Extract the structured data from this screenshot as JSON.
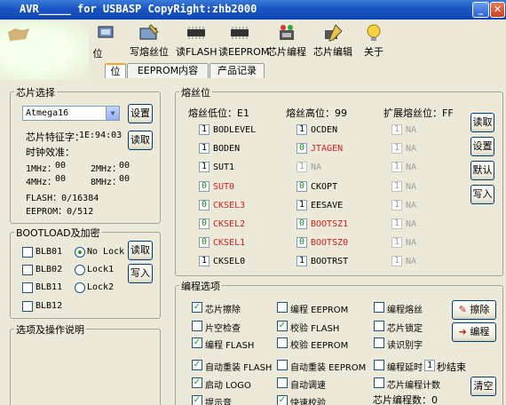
{
  "window": {
    "title": "AVR_____ for USBASP CopyRight:zhb2000"
  },
  "toolbar": {
    "items": [
      {
        "label": "位",
        "icon": "read-fuse-icon"
      },
      {
        "label": "写熔丝位",
        "icon": "write-fuse-icon"
      },
      {
        "label": "读FLASH",
        "icon": "chip-icon"
      },
      {
        "label": "读EEPROM",
        "icon": "chip-icon"
      },
      {
        "label": "芯片编程",
        "icon": "program-chip-icon"
      },
      {
        "label": "芯片编辑",
        "icon": "edit-chip-icon"
      },
      {
        "label": "关于",
        "icon": "lightbulb-icon"
      }
    ]
  },
  "tabs": [
    "位",
    "EEPROM内容",
    "产品记录"
  ],
  "chip_select": {
    "title": "芯片选择",
    "chip": "Atmega16",
    "settings_btn": "设置",
    "signature_label": "芯片特征字：",
    "signature_value": "1E:94:03",
    "read_btn": "读取",
    "clock_label": "时钟效准：",
    "clocks": [
      {
        "label": "1MHz：",
        "value": "00"
      },
      {
        "label": "2MHz：",
        "value": "00"
      },
      {
        "label": "4MHz：",
        "value": "00"
      },
      {
        "label": "8MHz：",
        "value": "00"
      }
    ],
    "flash_text": "FLASH：0/16384",
    "eeprom_text": "EEPROM：0/512"
  },
  "bootload": {
    "title": "BOOTLOAD及加密",
    "checks": [
      "BLB01",
      "BLB02",
      "BLB11",
      "BLB12"
    ],
    "radios": [
      "No Lock",
      "Lock1",
      "Lock2"
    ],
    "selected_radio": "No Lock",
    "read_btn": "读取",
    "write_btn": "写入"
  },
  "ops": {
    "title": "选项及操作说明"
  },
  "fuse": {
    "title": "熔丝位",
    "low_label": "熔丝低位：E1",
    "high_label": "熔丝高位：99",
    "ext_label": "扩展熔丝位：FF",
    "low": [
      {
        "v": "1",
        "name": "BODLEVEL",
        "style": "normal"
      },
      {
        "v": "1",
        "name": "BODEN",
        "style": "normal"
      },
      {
        "v": "1",
        "name": "SUT1",
        "style": "normal"
      },
      {
        "v": "0",
        "name": "SUT0",
        "style": "red"
      },
      {
        "v": "0",
        "name": "CKSEL3",
        "style": "red"
      },
      {
        "v": "0",
        "name": "CKSEL2",
        "style": "red"
      },
      {
        "v": "0",
        "name": "CKSEL1",
        "style": "red"
      },
      {
        "v": "1",
        "name": "CKSEL0",
        "style": "normal"
      }
    ],
    "high": [
      {
        "v": "1",
        "name": "OCDEN",
        "style": "normal"
      },
      {
        "v": "0",
        "name": "JTAGEN",
        "style": "red"
      },
      {
        "v": "1",
        "name": "NA",
        "style": "dim"
      },
      {
        "v": "0",
        "name": "CKOPT",
        "style": "normal"
      },
      {
        "v": "1",
        "name": "EESAVE",
        "style": "normal"
      },
      {
        "v": "0",
        "name": "BOOTSZ1",
        "style": "red"
      },
      {
        "v": "0",
        "name": "BOOTSZ0",
        "style": "red"
      },
      {
        "v": "1",
        "name": "BOOTRST",
        "style": "normal"
      }
    ],
    "ext": [
      {
        "v": "1",
        "name": "NA"
      },
      {
        "v": "1",
        "name": "NA"
      },
      {
        "v": "1",
        "name": "NA"
      },
      {
        "v": "1",
        "name": "NA"
      },
      {
        "v": "1",
        "name": "NA"
      },
      {
        "v": "1",
        "name": "NA"
      },
      {
        "v": "1",
        "name": "NA"
      },
      {
        "v": "1",
        "name": "NA"
      }
    ],
    "buttons": [
      "读取",
      "设置",
      "默认",
      "写入"
    ]
  },
  "prog": {
    "title": "编程选项",
    "options": [
      {
        "label": "芯片擦除",
        "checked": true
      },
      {
        "label": "编程 EEPROM",
        "checked": false
      },
      {
        "label": "编程熔丝",
        "checked": false
      },
      {
        "label": "片空检查",
        "checked": false
      },
      {
        "label": "校验 FLASH",
        "checked": true
      },
      {
        "label": "芯片锁定",
        "checked": false
      },
      {
        "label": "编程 FLASH",
        "checked": true
      },
      {
        "label": "校验 EEPROM",
        "checked": false
      },
      {
        "label": "读识别字",
        "checked": false
      },
      {
        "label": "自动重装 FLASH",
        "checked": true
      },
      {
        "label": "自动重装 EEPROM",
        "checked": false
      },
      {
        "label": "编程延时",
        "checked": false
      },
      {
        "label": "启动 LOGO",
        "checked": true
      },
      {
        "label": "自动调速",
        "checked": false
      },
      {
        "label": "芯片编程计数",
        "checked": false
      },
      {
        "label": "提示音",
        "checked": true
      },
      {
        "label": "快速校验",
        "checked": true
      }
    ],
    "delay_value": "1",
    "delay_suffix": "秒结束",
    "count_label": "芯片编程数：0",
    "erase_btn": "擦除",
    "program_btn": "编程",
    "clear_btn": "清空"
  },
  "colors": {
    "title_bar": "#1b55c4",
    "red_fuse": "#d21e1e",
    "check_green": "#21a121"
  }
}
